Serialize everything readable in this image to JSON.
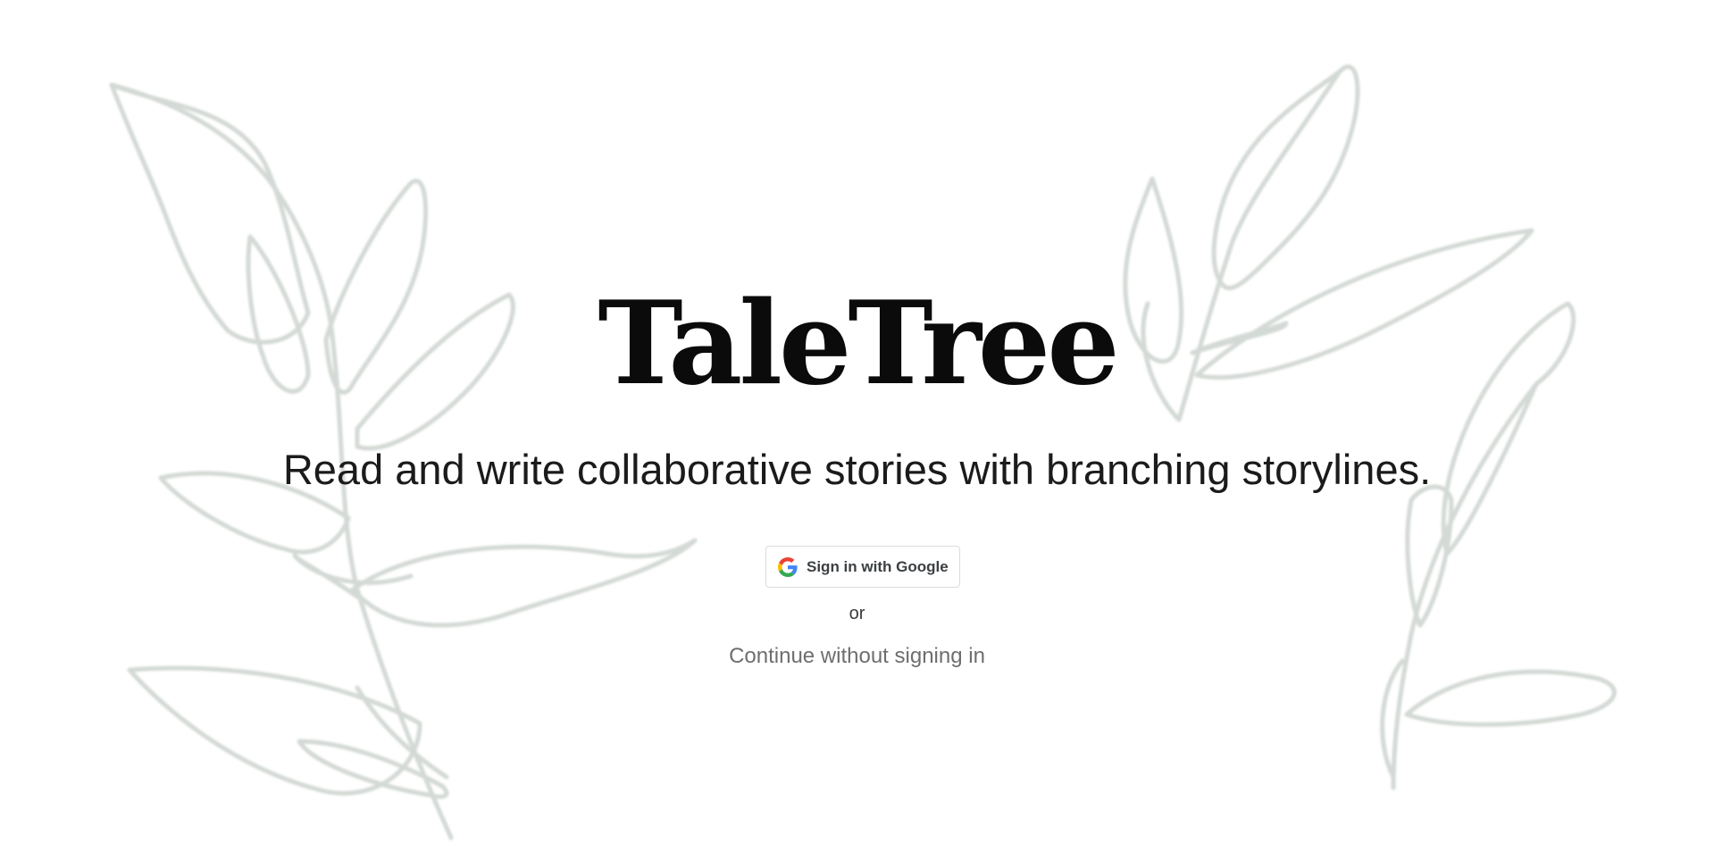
{
  "app": {
    "title": "TaleTree",
    "tagline": "Read and write collaborative stories with branching storylines."
  },
  "auth": {
    "google_button_label": "Sign in with Google",
    "google_icon": "google-g-icon",
    "separator": "or",
    "guest_link_label": "Continue without signing in"
  },
  "background": {
    "decoration": "leaf-branches-illustration"
  },
  "colors": {
    "background": "#ffffff",
    "title": "#0b0b0b",
    "tagline": "#1b1b1b",
    "link": "#6e6e6e",
    "leaf_stroke": "#d3d9d4",
    "google_blue": "#4285F4",
    "google_red": "#EA4335",
    "google_yellow": "#FBBC05",
    "google_green": "#34A853"
  }
}
